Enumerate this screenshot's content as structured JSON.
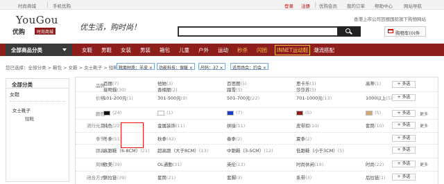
{
  "topbar": {
    "site": "时尚商城",
    "mobile": "手机优购",
    "login": "登录",
    "register": "注册",
    "vip": "优购会员",
    "orders": "我的订单",
    "links": [
      "帮助中心",
      "网站导航"
    ]
  },
  "header": {
    "logo_en": "YouGou",
    "logo_cn": "优购",
    "logo_tag": "时尚商城",
    "slogan": "优生活，购时尚！",
    "note": "香港上市公司百丽国际旗下购物网站",
    "search_value": "",
    "cart_label": "购物车(0)件",
    "cart_count": "0"
  },
  "nav": {
    "all_label": "全部商品分类",
    "items": [
      {
        "label": "女鞋",
        "style": "normal"
      },
      {
        "label": "男鞋",
        "style": "normal"
      },
      {
        "label": "女装",
        "style": "normal"
      },
      {
        "label": "男装",
        "style": "normal"
      },
      {
        "label": "箱包",
        "style": "normal"
      },
      {
        "label": "儿童",
        "style": "normal"
      },
      {
        "label": "户外",
        "style": "normal"
      },
      {
        "label": "运动",
        "style": "normal"
      },
      {
        "label": "秒杀",
        "style": "hl"
      },
      {
        "label": "闪团",
        "style": "hl"
      },
      {
        "label": "INNET运动鞋",
        "style": "box"
      },
      {
        "label": "潮流搭配",
        "style": "normal"
      }
    ]
  },
  "breadcrumb": {
    "text": "您已选择：全部分类 > 鞋包 > 女鞋 > 女士靴子 > 短靴",
    "chips": [
      "靴面材质：羊皮 ×",
      "功能科技：保暖 ×",
      "尺码：37 ×",
      "适用场合：约会 ×"
    ]
  },
  "sidebar": {
    "title": "全部分类",
    "level1": "女鞋",
    "level2": "女士靴子",
    "level3": "短靴"
  },
  "filters": [
    {
      "label": "品牌",
      "opts": [
        {
          "t": "百丽",
          "n": "(7)"
        },
        {
          "t": "他她",
          "n": "(3)"
        },
        {
          "t": "百思图",
          "n": "(5)"
        },
        {
          "t": "思卡乐",
          "n": "(1)"
        },
        {
          "t": "高蒂",
          "n": "(1)"
        },
        {
          "t": "接吻猫",
          "n": "(30)"
        },
        {
          "t": "香楠丽",
          "n": "(2)"
        },
        {
          "t": "踏雪",
          "n": "(5)"
        },
        {
          "t": "莎莎苏",
          "n": "(5)"
        }
      ],
      "btn": "+ 多选",
      "more": ""
    },
    {
      "label": "价格",
      "opts": [
        {
          "t": "101-200元",
          "n": "(1)"
        },
        {
          "t": "301-500元",
          "n": "(9)"
        },
        {
          "t": "501-700元",
          "n": "(22)"
        },
        {
          "t": "701-1000元",
          "n": "(13)"
        },
        {
          "t": "1000以上",
          "n": "(5)"
        }
      ],
      "btn": "+ 多选",
      "more": ""
    },
    {
      "label": "颜色",
      "opts": [
        {
          "t": "",
          "n": "(24)"
        },
        {
          "t": "",
          "n": "(1)"
        },
        {
          "t": "",
          "n": "(7)"
        },
        {
          "t": "",
          "n": "(5)"
        },
        {
          "t": "",
          "n": "(5)"
        }
      ],
      "colors": [
        "#111111",
        "#ffffff",
        "#1a3cc8",
        "#8a1d1d",
        "#d2a77a"
      ],
      "btn": "+ 多选",
      "more": "更多"
    },
    {
      "label": "流行元素",
      "opts": [
        {
          "t": "纯色",
          "n": "(22)"
        },
        {
          "t": "金属装饰",
          "n": "(11)"
        },
        {
          "t": "拼接",
          "n": "(11)"
        },
        {
          "t": "皮带扣",
          "n": "(10)"
        },
        {
          "t": "套筒",
          "n": "(10)"
        }
      ],
      "btn": "+ 多选",
      "more": "更多"
    },
    {
      "label": "季节",
      "opts": [
        {
          "t": "冬季",
          "n": "(51)"
        },
        {
          "t": "秋季",
          "n": "(42)"
        },
        {
          "t": "春季",
          "n": "(2)"
        },
        {
          "t": "夏季",
          "n": "(2)"
        }
      ],
      "btn": "+ 多选",
      "more": ""
    },
    {
      "label": "跟高",
      "opts": [
        {
          "t": "高跟鞋（6-8CM）",
          "n": "(21)"
        },
        {
          "t": "超高跟（大于8CM）",
          "n": "(13)"
        },
        {
          "t": "中跟鞋（3-5CM）",
          "n": "(12)"
        },
        {
          "t": "低跟鞋（小于3CM）",
          "n": "(5)"
        }
      ],
      "btn": "+ 多选",
      "more": ""
    },
    {
      "label": "风格",
      "opts": [
        {
          "t": "欧美",
          "n": "(39)"
        },
        {
          "t": "OL通勤",
          "n": "(31)"
        },
        {
          "t": "英伦",
          "n": "(13)"
        },
        {
          "t": "时尚休闲",
          "n": "(19)"
        },
        {
          "t": "时尚",
          "n": "(22)"
        }
      ],
      "btn": "+ 多选",
      "more": "更多"
    },
    {
      "label": "闭合方式",
      "opts": [
        {
          "t": "侧拉链",
          "n": "(39)"
        },
        {
          "t": "套筒",
          "n": "(21)"
        },
        {
          "t": "套脚",
          "n": "(3)"
        },
        {
          "t": "系带",
          "n": "(3)"
        },
        {
          "t": "后拉链",
          "n": "(1)"
        }
      ],
      "btn": "+ 多选",
      "more": ""
    }
  ]
}
